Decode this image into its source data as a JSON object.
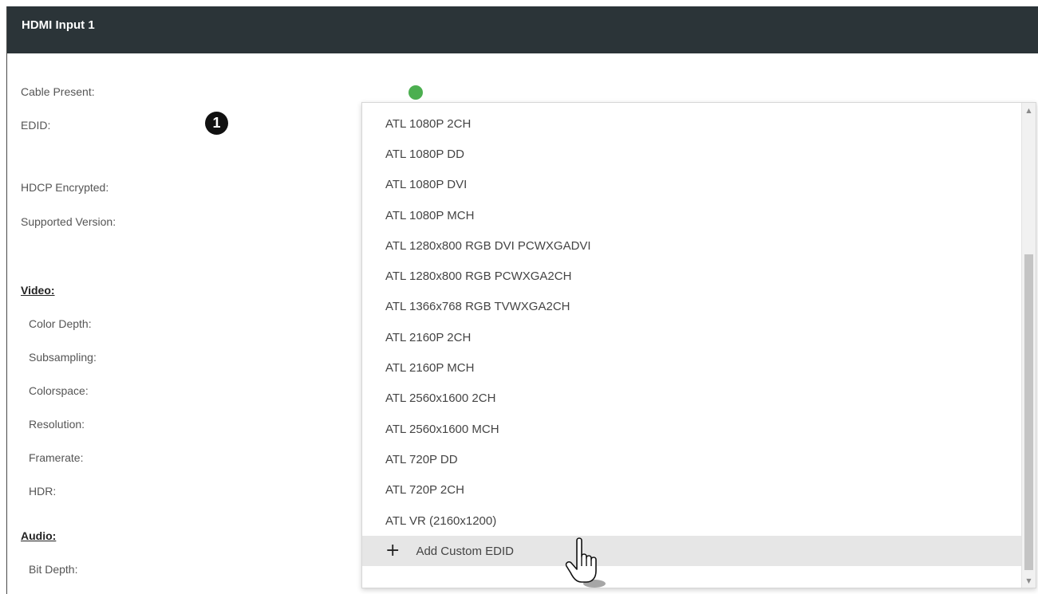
{
  "header": {
    "title": "HDMI Input 1"
  },
  "fields": {
    "cable_present": "Cable Present:",
    "edid": "EDID:",
    "hdcp_encrypted": "HDCP Encrypted:",
    "supported_version": "Supported Version:"
  },
  "video": {
    "heading": "Video:",
    "color_depth": "Color Depth:",
    "subsampling": "Subsampling:",
    "colorspace": "Colorspace:",
    "resolution": "Resolution:",
    "framerate": "Framerate:",
    "hdr": "HDR:"
  },
  "audio": {
    "heading": "Audio:",
    "bit_depth": "Bit Depth:"
  },
  "status": {
    "cable_color": "#4caf50"
  },
  "callout": {
    "number": "1"
  },
  "edid_dropdown": {
    "options": [
      "ATL 1080P 2CH",
      "ATL 1080P DD",
      "ATL 1080P DVI",
      "ATL 1080P MCH",
      "ATL 1280x800 RGB DVI PCWXGADVI",
      "ATL 1280x800 RGB PCWXGA2CH",
      "ATL 1366x768 RGB TVWXGA2CH",
      "ATL 2160P 2CH",
      "ATL 2160P MCH",
      "ATL 2560x1600 2CH",
      "ATL 2560x1600 MCH",
      "ATL 720P DD",
      "ATL 720P 2CH",
      "ATL VR (2160x1200)"
    ],
    "add_custom_label": "Add Custom EDID",
    "add_icon": "plus-icon"
  },
  "colors": {
    "header_bg": "#2b3438",
    "hover_bg": "#e6e6e6"
  }
}
